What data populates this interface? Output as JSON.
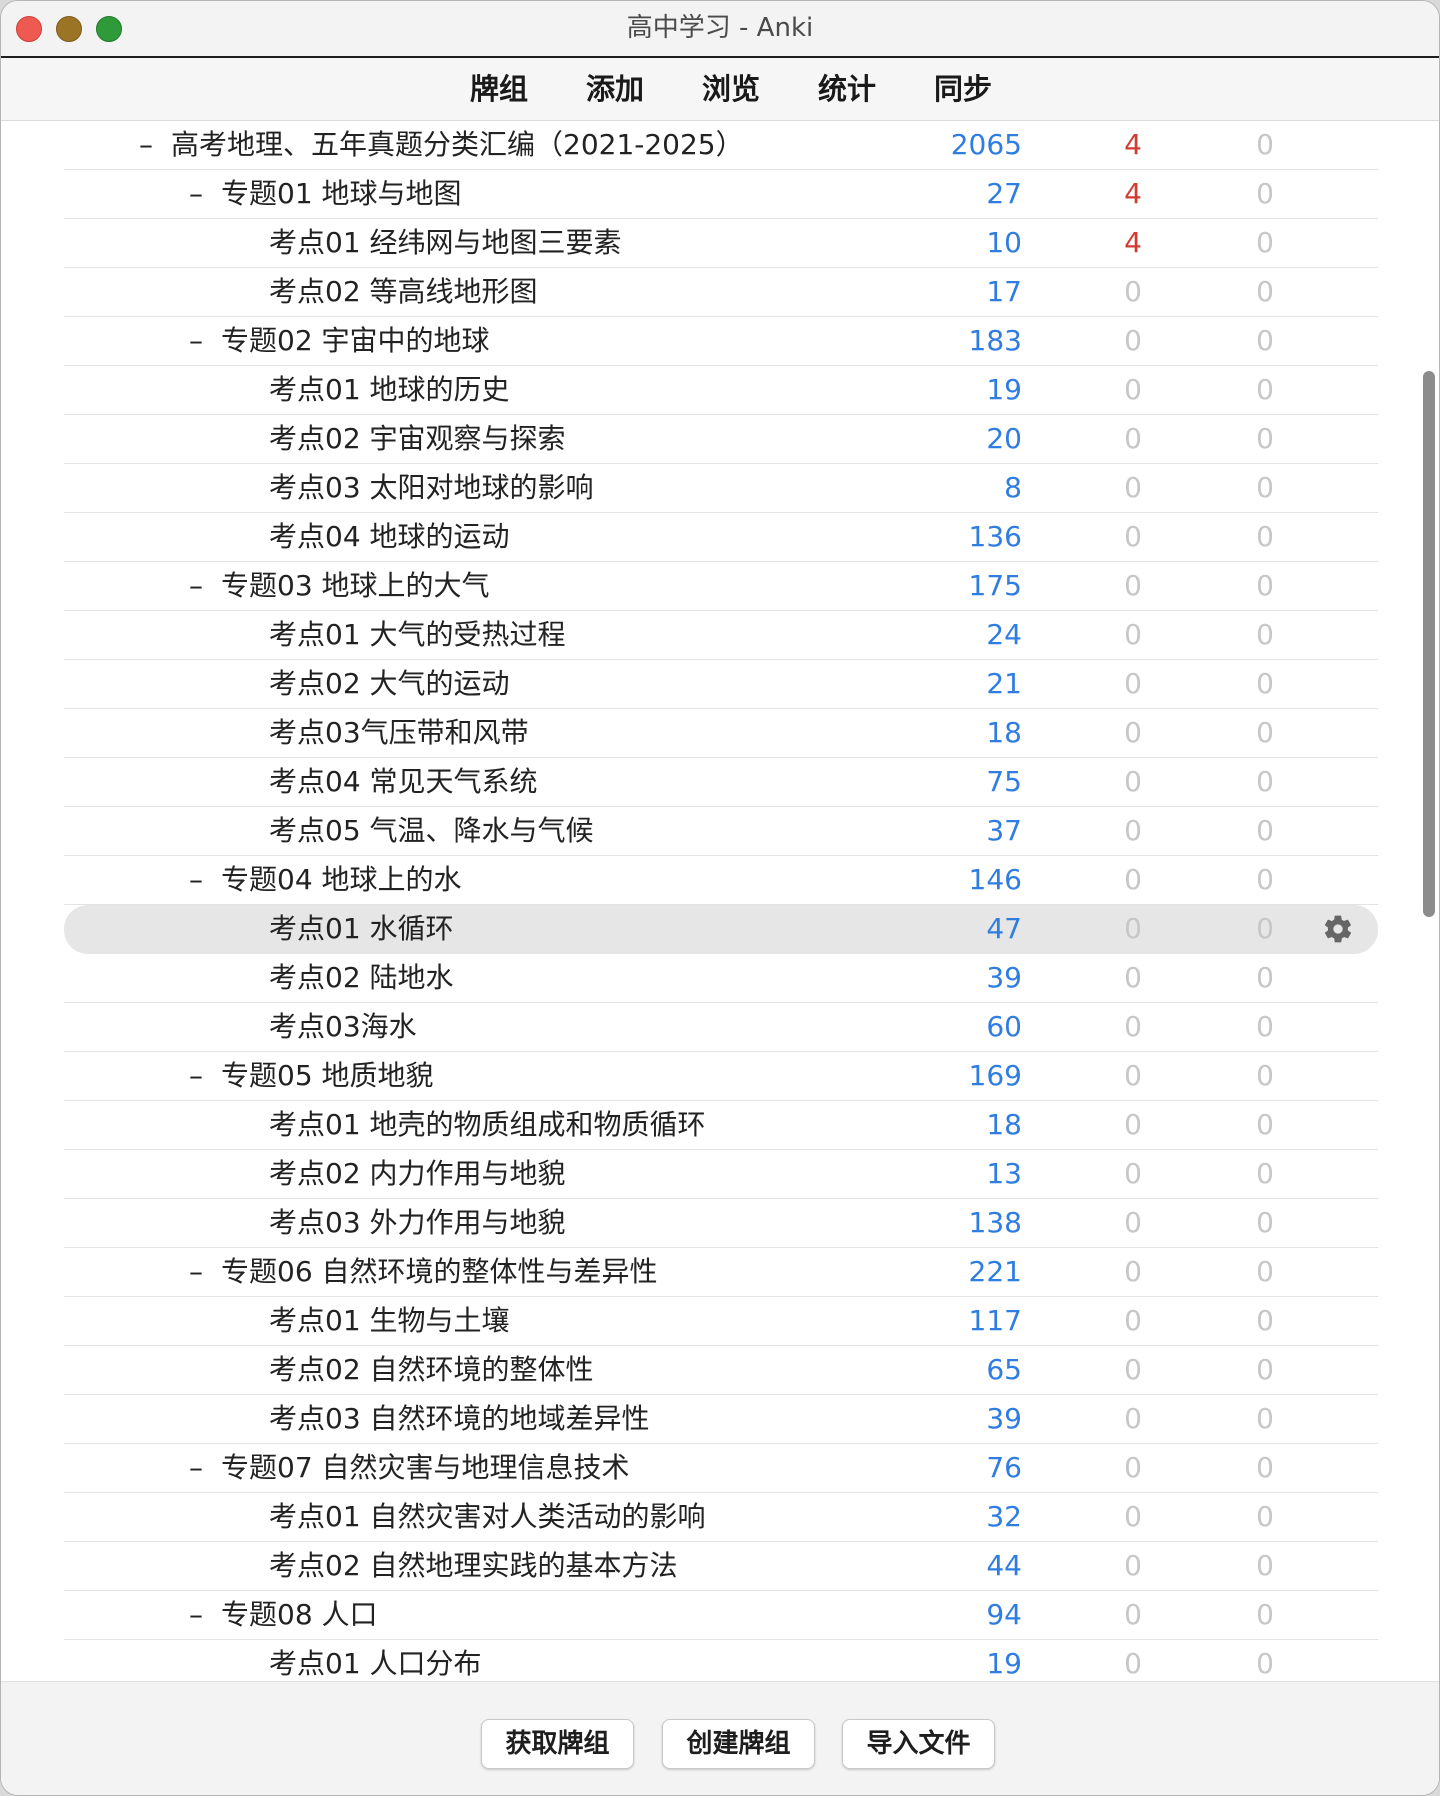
{
  "window": {
    "title": "高中学习 - Anki"
  },
  "toolbar": {
    "tabs": [
      "牌组",
      "添加",
      "浏览",
      "统计",
      "同步"
    ]
  },
  "decks": [
    {
      "level": 0,
      "collapse": "–",
      "name": "高考地理、五年真题分类汇编（2021-2025）",
      "new": "2065",
      "learn": "4",
      "due": "0",
      "learn_active": true
    },
    {
      "level": 1,
      "collapse": "–",
      "name": "专题01 地球与地图",
      "new": "27",
      "learn": "4",
      "due": "0",
      "learn_active": true
    },
    {
      "level": 2,
      "collapse": "",
      "name": "考点01 经纬网与地图三要素",
      "new": "10",
      "learn": "4",
      "due": "0",
      "learn_active": true
    },
    {
      "level": 2,
      "collapse": "",
      "name": "考点02 等高线地形图",
      "new": "17",
      "learn": "0",
      "due": "0"
    },
    {
      "level": 1,
      "collapse": "–",
      "name": "专题02 宇宙中的地球",
      "new": "183",
      "learn": "0",
      "due": "0"
    },
    {
      "level": 2,
      "collapse": "",
      "name": "考点01 地球的历史",
      "new": "19",
      "learn": "0",
      "due": "0"
    },
    {
      "level": 2,
      "collapse": "",
      "name": "考点02 宇宙观察与探索",
      "new": "20",
      "learn": "0",
      "due": "0"
    },
    {
      "level": 2,
      "collapse": "",
      "name": "考点03 太阳对地球的影响",
      "new": "8",
      "learn": "0",
      "due": "0"
    },
    {
      "level": 2,
      "collapse": "",
      "name": "考点04 地球的运动",
      "new": "136",
      "learn": "0",
      "due": "0"
    },
    {
      "level": 1,
      "collapse": "–",
      "name": "专题03 地球上的大气",
      "new": "175",
      "learn": "0",
      "due": "0"
    },
    {
      "level": 2,
      "collapse": "",
      "name": "考点01 大气的受热过程",
      "new": "24",
      "learn": "0",
      "due": "0"
    },
    {
      "level": 2,
      "collapse": "",
      "name": "考点02 大气的运动",
      "new": "21",
      "learn": "0",
      "due": "0"
    },
    {
      "level": 2,
      "collapse": "",
      "name": "考点03气压带和风带",
      "new": "18",
      "learn": "0",
      "due": "0"
    },
    {
      "level": 2,
      "collapse": "",
      "name": "考点04 常见天气系统",
      "new": "75",
      "learn": "0",
      "due": "0"
    },
    {
      "level": 2,
      "collapse": "",
      "name": "考点05 气温、降水与气候",
      "new": "37",
      "learn": "0",
      "due": "0"
    },
    {
      "level": 1,
      "collapse": "–",
      "name": "专题04 地球上的水",
      "new": "146",
      "learn": "0",
      "due": "0"
    },
    {
      "level": 2,
      "collapse": "",
      "name": "考点01 水循环",
      "new": "47",
      "learn": "0",
      "due": "0",
      "selected": true
    },
    {
      "level": 2,
      "collapse": "",
      "name": "考点02 陆地水",
      "new": "39",
      "learn": "0",
      "due": "0"
    },
    {
      "level": 2,
      "collapse": "",
      "name": "考点03海水",
      "new": "60",
      "learn": "0",
      "due": "0"
    },
    {
      "level": 1,
      "collapse": "–",
      "name": "专题05 地质地貌",
      "new": "169",
      "learn": "0",
      "due": "0"
    },
    {
      "level": 2,
      "collapse": "",
      "name": "考点01 地壳的物质组成和物质循环",
      "new": "18",
      "learn": "0",
      "due": "0"
    },
    {
      "level": 2,
      "collapse": "",
      "name": "考点02 内力作用与地貌",
      "new": "13",
      "learn": "0",
      "due": "0"
    },
    {
      "level": 2,
      "collapse": "",
      "name": "考点03 外力作用与地貌",
      "new": "138",
      "learn": "0",
      "due": "0"
    },
    {
      "level": 1,
      "collapse": "–",
      "name": "专题06 自然环境的整体性与差异性",
      "new": "221",
      "learn": "0",
      "due": "0"
    },
    {
      "level": 2,
      "collapse": "",
      "name": "考点01 生物与土壤",
      "new": "117",
      "learn": "0",
      "due": "0"
    },
    {
      "level": 2,
      "collapse": "",
      "name": "考点02 自然环境的整体性",
      "new": "65",
      "learn": "0",
      "due": "0"
    },
    {
      "level": 2,
      "collapse": "",
      "name": "考点03 自然环境的地域差异性",
      "new": "39",
      "learn": "0",
      "due": "0"
    },
    {
      "level": 1,
      "collapse": "–",
      "name": "专题07 自然灾害与地理信息技术",
      "new": "76",
      "learn": "0",
      "due": "0"
    },
    {
      "level": 2,
      "collapse": "",
      "name": "考点01 自然灾害对人类活动的影响",
      "new": "32",
      "learn": "0",
      "due": "0"
    },
    {
      "level": 2,
      "collapse": "",
      "name": "考点02 自然地理实践的基本方法",
      "new": "44",
      "learn": "0",
      "due": "0"
    },
    {
      "level": 1,
      "collapse": "–",
      "name": "专题08 人口",
      "new": "94",
      "learn": "0",
      "due": "0"
    },
    {
      "level": 2,
      "collapse": "",
      "name": "考点01 人口分布",
      "new": "19",
      "learn": "0",
      "due": "0"
    }
  ],
  "bottom": {
    "get_shared": "获取牌组",
    "create_deck": "创建牌组",
    "import_file": "导入文件"
  },
  "icons": {
    "deck_options": "gear-icon"
  },
  "colors": {
    "new": "#2f7de1",
    "learn_active": "#d23b2f",
    "zero": "#c7c7c7"
  }
}
